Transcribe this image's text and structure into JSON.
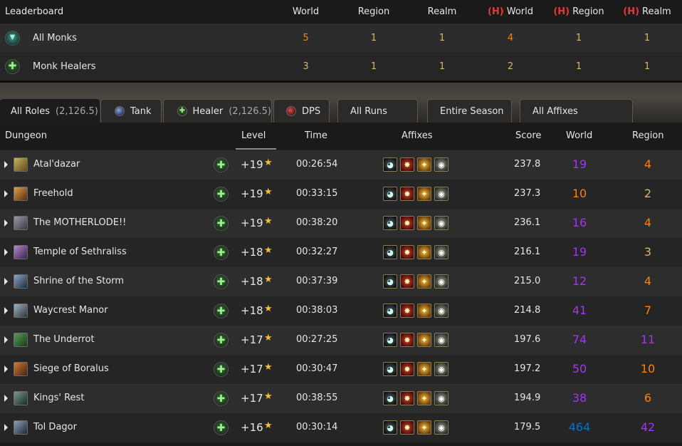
{
  "leaderboard": {
    "title": "Leaderboard",
    "columns": [
      {
        "label": "World",
        "heroic": false
      },
      {
        "label": "Region",
        "heroic": false
      },
      {
        "label": "Realm",
        "heroic": false
      },
      {
        "label": "World",
        "heroic": true
      },
      {
        "label": "Region",
        "heroic": true
      },
      {
        "label": "Realm",
        "heroic": true
      }
    ],
    "heroic_mark": "(H)",
    "rows": [
      {
        "name": "All Monks",
        "icon": "monk-class-icon",
        "values": [
          "5",
          "1",
          "1",
          "4",
          "1",
          "1"
        ]
      },
      {
        "name": "Monk Healers",
        "icon": "healer-cross-icon",
        "values": [
          "3",
          "1",
          "1",
          "2",
          "1",
          "1"
        ]
      }
    ]
  },
  "tabs": {
    "roles": [
      {
        "label": "All Roles",
        "count": "(2,126.5)",
        "icon": null
      },
      {
        "label": "Tank",
        "count": "",
        "icon": "tank-icon"
      },
      {
        "label": "Healer",
        "count": "(2,126.5)",
        "icon": "healer-icon"
      },
      {
        "label": "DPS",
        "count": "",
        "icon": "dps-icon"
      }
    ],
    "filters": [
      {
        "label": "All Runs"
      },
      {
        "label": "Entire Season"
      },
      {
        "label": "All Affixes"
      }
    ]
  },
  "runs_table": {
    "headers": {
      "dungeon": "Dungeon",
      "level": "Level",
      "time": "Time",
      "affixes": "Affixes",
      "score": "Score",
      "world": "World",
      "region": "Region"
    },
    "rows": [
      {
        "dungeon": "Atal'dazar",
        "level": "+19",
        "time": "00:26:54",
        "score": "237.8",
        "world": "19",
        "world_color": "#a335ee",
        "region": "4",
        "region_color": "#ff8000"
      },
      {
        "dungeon": "Freehold",
        "level": "+19",
        "time": "00:33:15",
        "score": "237.3",
        "world": "10",
        "world_color": "#ff8000",
        "region": "2",
        "region_color": "#dab56a"
      },
      {
        "dungeon": "The MOTHERLODE!!",
        "level": "+19",
        "time": "00:38:20",
        "score": "236.1",
        "world": "16",
        "world_color": "#a335ee",
        "region": "4",
        "region_color": "#ff8000"
      },
      {
        "dungeon": "Temple of Sethraliss",
        "level": "+18",
        "time": "00:32:27",
        "score": "216.1",
        "world": "19",
        "world_color": "#a335ee",
        "region": "3",
        "region_color": "#dab56a"
      },
      {
        "dungeon": "Shrine of the Storm",
        "level": "+18",
        "time": "00:37:39",
        "score": "215.0",
        "world": "12",
        "world_color": "#a335ee",
        "region": "4",
        "region_color": "#ff8000"
      },
      {
        "dungeon": "Waycrest Manor",
        "level": "+18",
        "time": "00:38:03",
        "score": "214.8",
        "world": "41",
        "world_color": "#a335ee",
        "region": "7",
        "region_color": "#ff8000"
      },
      {
        "dungeon": "The Underrot",
        "level": "+17",
        "time": "00:27:25",
        "score": "197.6",
        "world": "74",
        "world_color": "#a335ee",
        "region": "11",
        "region_color": "#a335ee"
      },
      {
        "dungeon": "Siege of Boralus",
        "level": "+17",
        "time": "00:30:47",
        "score": "197.2",
        "world": "50",
        "world_color": "#a335ee",
        "region": "10",
        "region_color": "#ff8000"
      },
      {
        "dungeon": "Kings' Rest",
        "level": "+17",
        "time": "00:38:55",
        "score": "194.9",
        "world": "38",
        "world_color": "#a335ee",
        "region": "6",
        "region_color": "#ff8000"
      },
      {
        "dungeon": "Tol Dagor",
        "level": "+16",
        "time": "00:30:14",
        "score": "179.5",
        "world": "464",
        "world_color": "#0070dd",
        "region": "42",
        "region_color": "#a335ee"
      }
    ],
    "affix_icons": [
      "tyrannical-icon",
      "bolstering-icon",
      "explosive-icon",
      "infested-icon"
    ]
  }
}
